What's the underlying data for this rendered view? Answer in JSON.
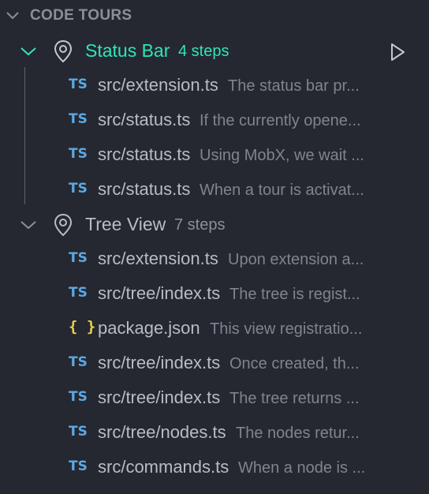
{
  "section": {
    "title": "CODE TOURS"
  },
  "tours": [
    {
      "name": "Status Bar",
      "steps_label": "4 steps",
      "active": true,
      "steps": [
        {
          "icon": "TS",
          "type": "ts",
          "file": "src/extension.ts",
          "desc": "The status bar pr..."
        },
        {
          "icon": "TS",
          "type": "ts",
          "file": "src/status.ts",
          "desc": "If the currently opene..."
        },
        {
          "icon": "TS",
          "type": "ts",
          "file": "src/status.ts",
          "desc": "Using MobX, we wait ..."
        },
        {
          "icon": "TS",
          "type": "ts",
          "file": "src/status.ts",
          "desc": "When a tour is activat..."
        }
      ]
    },
    {
      "name": "Tree View",
      "steps_label": "7 steps",
      "active": false,
      "steps": [
        {
          "icon": "TS",
          "type": "ts",
          "file": "src/extension.ts",
          "desc": "Upon extension a..."
        },
        {
          "icon": "TS",
          "type": "ts",
          "file": "src/tree/index.ts",
          "desc": "The tree is regist..."
        },
        {
          "icon": "{ }",
          "type": "json",
          "file": "package.json",
          "desc": "This view registratio..."
        },
        {
          "icon": "TS",
          "type": "ts",
          "file": "src/tree/index.ts",
          "desc": "Once created, th..."
        },
        {
          "icon": "TS",
          "type": "ts",
          "file": "src/tree/index.ts",
          "desc": "The tree returns ..."
        },
        {
          "icon": "TS",
          "type": "ts",
          "file": "src/tree/nodes.ts",
          "desc": "The nodes retur..."
        },
        {
          "icon": "TS",
          "type": "ts",
          "file": "src/commands.ts",
          "desc": "When a node is ..."
        }
      ]
    }
  ],
  "colors": {
    "background": "#252830",
    "active_tour": "#2ee6b8",
    "ts_icon": "#5aa9e6",
    "json_icon": "#e8d24a",
    "description": "#7f848d"
  },
  "icons": {
    "section_toggle": "chevron-down-icon",
    "tour_toggle": "chevron-down-icon",
    "tour": "map-pin-icon",
    "start_tour": "play-icon"
  }
}
